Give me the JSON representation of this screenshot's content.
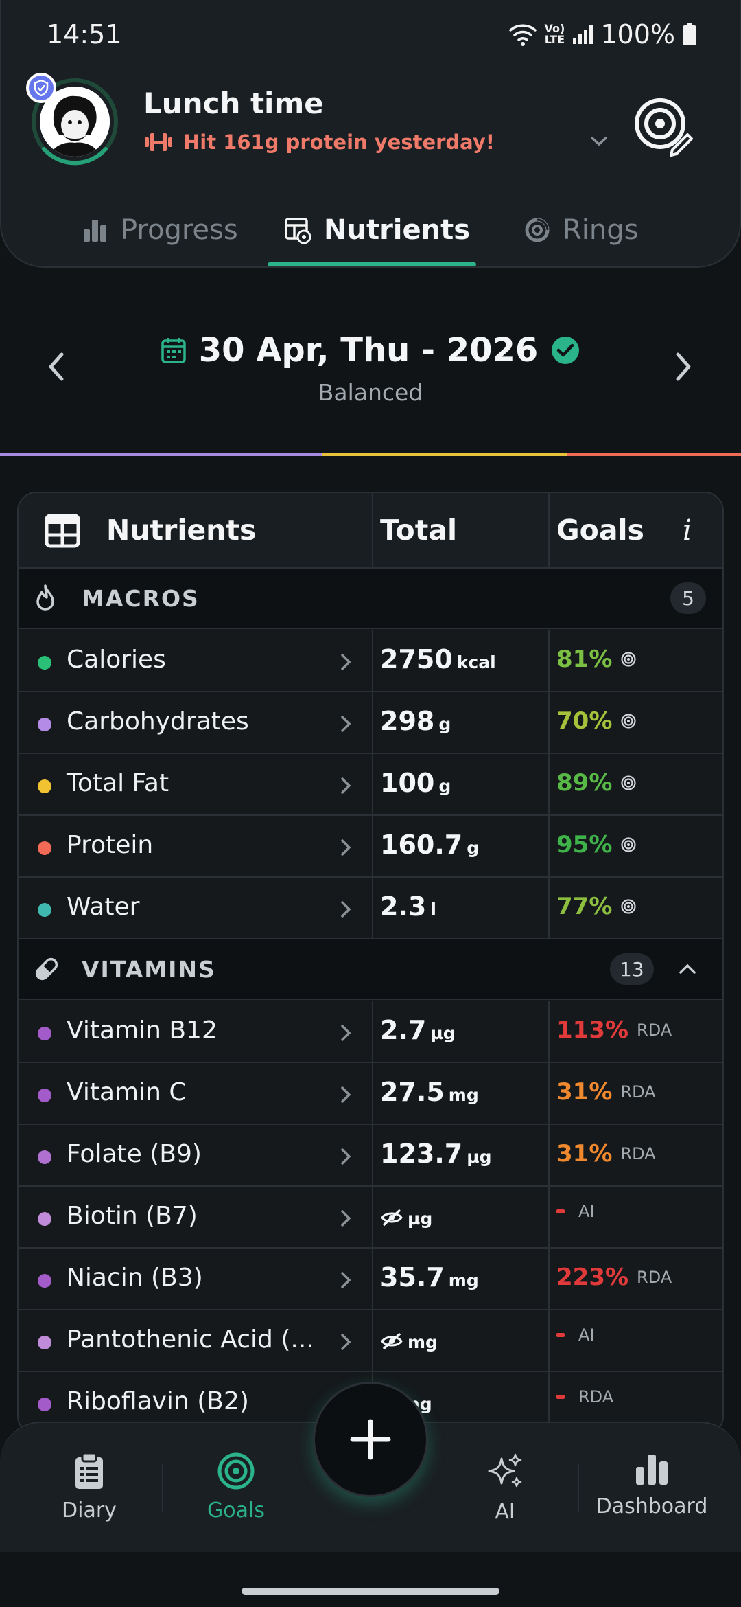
{
  "status_bar": {
    "time": "14:51",
    "network": "LTE",
    "battery": "100%"
  },
  "header": {
    "title": "Lunch time",
    "subtitle": "Hit 161g protein yesterday!"
  },
  "tabs": [
    {
      "label": "Progress",
      "icon": "bar-chart-icon",
      "active": false
    },
    {
      "label": "Nutrients",
      "icon": "table-eye-icon",
      "active": true
    },
    {
      "label": "Rings",
      "icon": "ring-icon",
      "active": false
    }
  ],
  "date_nav": {
    "date": "30 Apr, Thu - 2026",
    "status": "Balanced"
  },
  "table": {
    "headers": {
      "nutrients": "Nutrients",
      "total": "Total",
      "goals": "Goals",
      "info": "i"
    },
    "macros": {
      "label": "MACROS",
      "count": "5",
      "rows": [
        {
          "name": "Calories",
          "dot": "#2bc077",
          "value": "2750",
          "unit": "kcal",
          "pct": "81%",
          "pct_color": "#7bc043",
          "goal_icon": "target-icon"
        },
        {
          "name": "Carbohydrates",
          "dot": "#b58be8",
          "value": "298",
          "unit": "g",
          "pct": "70%",
          "pct_color": "#a6c23b",
          "goal_icon": "target-icon"
        },
        {
          "name": "Total Fat",
          "dot": "#f1c232",
          "value": "100",
          "unit": "g",
          "pct": "89%",
          "pct_color": "#58b947",
          "goal_icon": "target-icon"
        },
        {
          "name": "Protein",
          "dot": "#f06a55",
          "value": "160.7",
          "unit": "g",
          "pct": "95%",
          "pct_color": "#3fb34a",
          "goal_icon": "target-icon"
        },
        {
          "name": "Water",
          "dot": "#3fb8b0",
          "value": "2.3",
          "unit": "l",
          "pct": "77%",
          "pct_color": "#8cbf3f",
          "goal_icon": "target-icon"
        }
      ]
    },
    "vitamins": {
      "label": "VITAMINS",
      "count": "13",
      "rows": [
        {
          "name": "Vitamin B12",
          "dot": "#a35bc9",
          "value": "2.7",
          "unit": "µg",
          "pct": "113%",
          "pct_color": "#e03a3a",
          "goal": "RDA"
        },
        {
          "name": "Vitamin C",
          "dot": "#a35bc9",
          "value": "27.5",
          "unit": "mg",
          "pct": "31%",
          "pct_color": "#f0892e",
          "goal": "RDA"
        },
        {
          "name": "Folate (B9)",
          "dot": "#b070d0",
          "value": "123.7",
          "unit": "µg",
          "pct": "31%",
          "pct_color": "#f0892e",
          "goal": "RDA"
        },
        {
          "name": "Biotin (B7)",
          "dot": "#c08bd8",
          "value": "",
          "unit": "µg",
          "hidden": true,
          "pct": "",
          "goal": "AI"
        },
        {
          "name": "Niacin (B3)",
          "dot": "#a35bc9",
          "value": "35.7",
          "unit": "mg",
          "pct": "223%",
          "pct_color": "#e03a3a",
          "goal": "RDA"
        },
        {
          "name": "Pantothenic Acid (...",
          "dot": "#c08bd8",
          "value": "",
          "unit": "mg",
          "hidden": true,
          "pct": "",
          "goal": "AI"
        },
        {
          "name": "Riboflavin (B2)",
          "dot": "#a35bc9",
          "value": "",
          "unit": "ng",
          "hidden": true,
          "pct": "",
          "goal": "RDA"
        }
      ]
    }
  },
  "bottom_nav": {
    "items": [
      {
        "label": "Diary",
        "icon": "clipboard-icon"
      },
      {
        "label": "Goals",
        "icon": "target-icon"
      },
      {
        "label": "AI",
        "icon": "sparkle-icon"
      },
      {
        "label": "Dashboard",
        "icon": "bar-chart-icon"
      }
    ],
    "active": "Goals"
  },
  "colors": {
    "accent": "#2bb38a",
    "background": "#111417",
    "card": "#1a1f23",
    "subtitle": "#f07a6a"
  }
}
